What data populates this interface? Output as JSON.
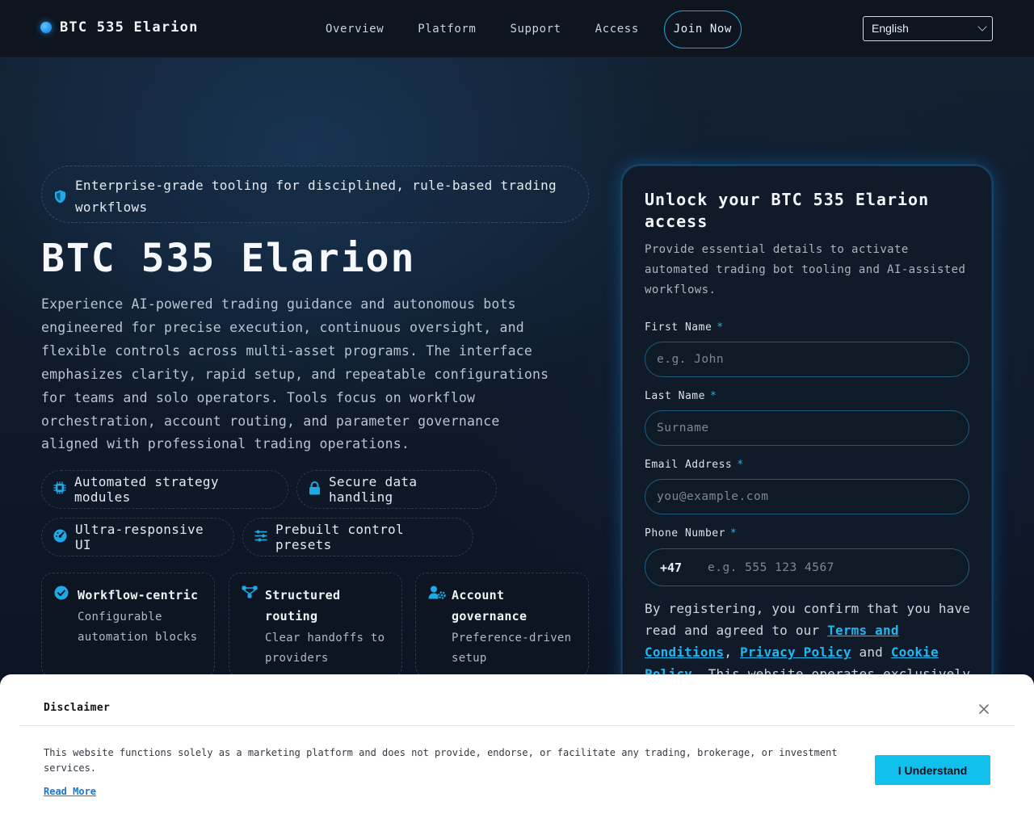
{
  "header": {
    "brand": "BTC 535 Elarion",
    "nav": [
      "Overview",
      "Platform",
      "Support",
      "Access"
    ],
    "join_label": "Join Now",
    "language": "English"
  },
  "hero": {
    "tagline": "Enterprise-grade tooling for disciplined, rule-based trading workflows",
    "title": "BTC 535 Elarion",
    "description": "Experience AI-powered trading guidance and autonomous bots engineered for precise execution, continuous oversight, and flexible controls across multi-asset programs. The interface emphasizes clarity, rapid setup, and repeatable configurations for teams and solo operators. Tools focus on workflow orchestration, account routing, and parameter governance aligned with professional trading operations.",
    "chips": [
      {
        "label": "Automated strategy modules",
        "icon": "chip-icon"
      },
      {
        "label": "Secure data handling",
        "icon": "lock-icon"
      },
      {
        "label": "Ultra-responsive UI",
        "icon": "speed-icon"
      },
      {
        "label": "Prebuilt control presets",
        "icon": "sliders-icon"
      }
    ],
    "cards": [
      {
        "title": "Workflow-centric",
        "sub": "Configurable automation blocks",
        "icon": "check-circle-icon"
      },
      {
        "title": "Structured routing",
        "sub": "Clear handoffs to providers",
        "icon": "routing-icon"
      },
      {
        "title": "Account governance",
        "sub": "Preference-driven setup",
        "icon": "user-gear-icon"
      }
    ]
  },
  "form": {
    "title": "Unlock your BTC 535 Elarion access",
    "subtitle": "Provide essential details to activate automated trading bot tooling and AI-assisted workflows.",
    "first_name": {
      "label": "First Name",
      "placeholder": "e.g. John"
    },
    "last_name": {
      "label": "Last Name",
      "placeholder": "Surname"
    },
    "email": {
      "label": "Email Address",
      "placeholder": "you@example.com"
    },
    "phone": {
      "label": "Phone Number",
      "code": "+47",
      "placeholder": "e.g. 555 123 4567"
    },
    "required_mark": "*",
    "consent": {
      "prefix": "By registering, you confirm that you have read and agreed to our ",
      "terms": "Terms and Conditions",
      "sep1": ", ",
      "privacy": "Privacy Policy",
      "sep2": " and ",
      "cookie": "Cookie Policy",
      "suffix": ". This website operates exclusively"
    }
  },
  "disclaimer": {
    "title": "Disclaimer",
    "text": "This website functions solely as a marketing platform and does not provide, endorse, or facilitate any trading, brokerage, or investment services.",
    "read_more": "Read More",
    "button": "I Understand"
  },
  "colors": {
    "accent": "#21b6f0",
    "background": "#0b1220",
    "button": "#12c0ee"
  }
}
